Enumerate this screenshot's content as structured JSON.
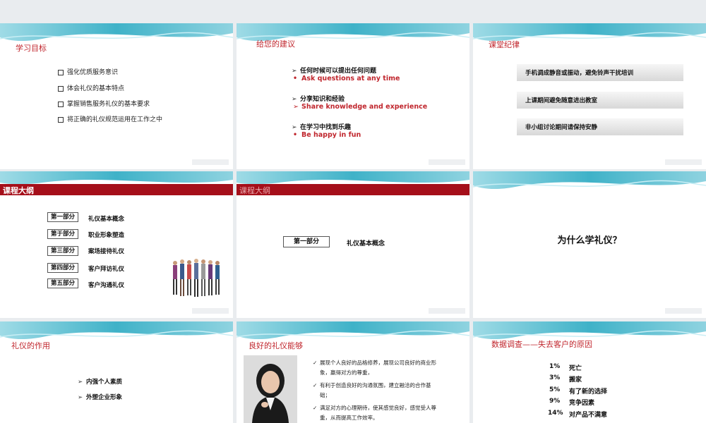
{
  "slides": {
    "s1": {
      "title": "学习目标",
      "items": [
        "强化优质服务意识",
        "体会礼仪的基本特点",
        "掌握销售服务礼仪的基本要求",
        "将正确的礼仪规范运用在工作之中"
      ]
    },
    "s2": {
      "title": "给您的建议",
      "items": [
        {
          "cn": "任何时候可以提出任何问题",
          "en": "Ask questions at any time"
        },
        {
          "cn": "分享知识和经验",
          "en": "Share knowledge and experience"
        },
        {
          "cn": "在学习中找到乐趣",
          "en": "Be happy in fun"
        }
      ]
    },
    "s3": {
      "title": "课堂纪律",
      "items": [
        "手机调成静音或振动，避免铃声干扰培训",
        "上课期间避免随意进出教室",
        "非小组讨论期间请保持安静"
      ]
    },
    "s4": {
      "title": "课程大纲",
      "parts": [
        {
          "label": "第一部分",
          "text": "礼仪基本概念"
        },
        {
          "label": "第于部分",
          "text": "职业形象塑造"
        },
        {
          "label": "第三部分",
          "text": "案场接待礼仪"
        },
        {
          "label": "第四部分",
          "text": "客户拜访礼仪"
        },
        {
          "label": "第五部分",
          "text": "客户沟通礼仪"
        }
      ]
    },
    "s5": {
      "title": "课程大纲",
      "label": "第一部分",
      "text": "礼仪基本概念"
    },
    "s6": {
      "heading": "为什么学礼仪？"
    },
    "s7": {
      "title": "礼仪的作用",
      "items": [
        "内强个人素质",
        "外塑企业形象"
      ]
    },
    "s8": {
      "title": "良好的礼仪能够",
      "items": [
        "展现个人良好的品格修养，展现公司良好的商业形象，赢得对方的尊重，",
        "有利于创造良好的沟通氛围，建立融洽的合作基础；",
        "满足对方的心理期待，使其感觉良好，感觉受人尊重，从而提高工作效率。"
      ]
    },
    "s9": {
      "title": "数据调查——失去客户的原因",
      "rows": [
        {
          "pct": "1%",
          "reason": "死亡"
        },
        {
          "pct": "3%",
          "reason": "搬家"
        },
        {
          "pct": "5%",
          "reason": "有了新的选择"
        },
        {
          "pct": "9%",
          "reason": "竞争因素"
        },
        {
          "pct": "14%",
          "reason": "对产品不满意"
        }
      ]
    }
  },
  "colors": {
    "accent_red": "#c0262d",
    "bar_red": "#a50f1a",
    "wave_teal": "#5fc1d2"
  }
}
